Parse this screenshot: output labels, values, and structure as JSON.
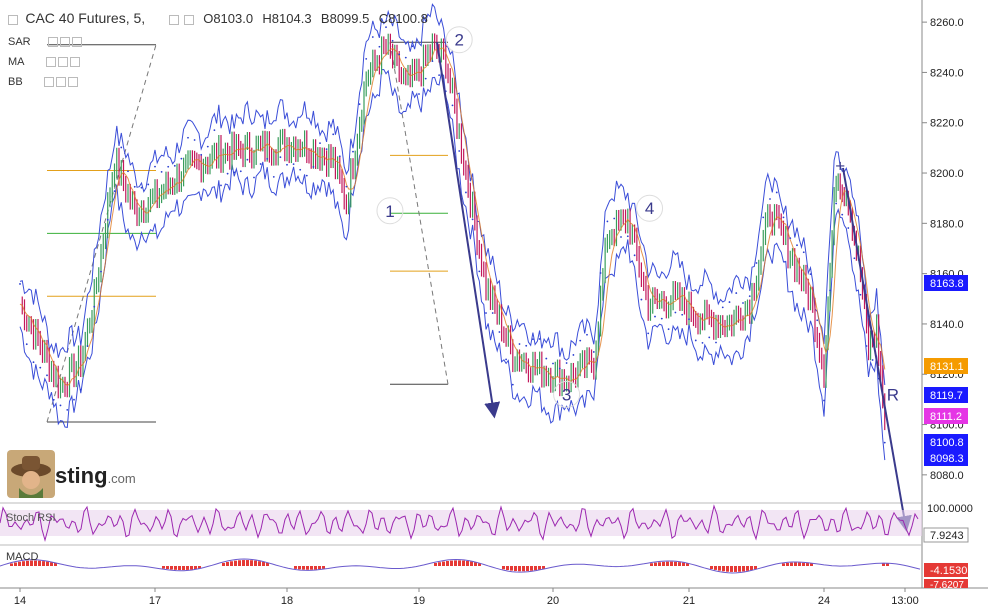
{
  "header": {
    "title": "CAC 40 Futures, 5,",
    "open": "O8103.0",
    "high": "H8104.3",
    "low": "B8099.5",
    "close": "C8100.8"
  },
  "indicators": [
    {
      "label": "SAR"
    },
    {
      "label": "MA"
    },
    {
      "label": "BB"
    }
  ],
  "sub_panels": {
    "stoch": {
      "label": "Stoch RSI",
      "top_value": "100.0000",
      "current_value": "7.9243"
    },
    "macd": {
      "label": "MACD",
      "value_1": "-4.1530",
      "value_2": "-7.6207"
    }
  },
  "logo": {
    "text": "sting",
    "suffix": ".com"
  },
  "colors": {
    "bollinger": "#3b4ed8",
    "sar": "#2b3fd0",
    "candle_up": "#3a9d5c",
    "candle_down": "#c2185b",
    "ma": "#e07b22",
    "arrow": "#3a3a8c",
    "stoch": "#9c27b0",
    "stoch_band": "#e9d3ec",
    "macd_hist": "#e53935"
  },
  "chart_data": {
    "type": "line",
    "title": "CAC 40 Futures, 5,",
    "xlabel": "",
    "ylabel": "",
    "x_ticks": [
      "14",
      "17",
      "18",
      "19",
      "20",
      "21",
      "24",
      "13:00"
    ],
    "y_ticks": [
      8080,
      8100,
      8120,
      8140,
      8160,
      8180,
      8200,
      8220,
      8240,
      8260
    ],
    "ylim": [
      8070,
      8268
    ],
    "grid": false,
    "price_path": [
      [
        0,
        8148
      ],
      [
        0.3,
        8115
      ],
      [
        0.45,
        8125
      ],
      [
        0.55,
        8150
      ],
      [
        0.7,
        8205
      ],
      [
        0.85,
        8185
      ],
      [
        1.0,
        8190
      ],
      [
        1.2,
        8200
      ],
      [
        1.5,
        8208
      ],
      [
        1.8,
        8210
      ],
      [
        2.1,
        8212
      ],
      [
        2.35,
        8205
      ],
      [
        2.45,
        8188
      ],
      [
        2.6,
        8238
      ],
      [
        2.75,
        8250
      ],
      [
        2.9,
        8235
      ],
      [
        3.0,
        8240
      ],
      [
        3.1,
        8250
      ],
      [
        3.2,
        8245
      ],
      [
        3.35,
        8200
      ],
      [
        3.5,
        8155
      ],
      [
        3.7,
        8128
      ],
      [
        3.9,
        8122
      ],
      [
        4.1,
        8118
      ],
      [
        4.3,
        8125
      ],
      [
        4.4,
        8175
      ],
      [
        4.55,
        8182
      ],
      [
        4.7,
        8148
      ],
      [
        4.9,
        8150
      ],
      [
        5.1,
        8142
      ],
      [
        5.3,
        8140
      ],
      [
        5.45,
        8148
      ],
      [
        5.6,
        8185
      ],
      [
        5.75,
        8168
      ],
      [
        5.9,
        8150
      ],
      [
        6.0,
        8122
      ],
      [
        6.15,
        8200
      ],
      [
        6.3,
        8190
      ],
      [
        6.45,
        8160
      ],
      [
        6.55,
        8130
      ],
      [
        6.65,
        8138
      ],
      [
        6.75,
        8100.8
      ]
    ],
    "price_labels": [
      {
        "value": 8163.8,
        "text": "8163.8",
        "color": "#1a1aff"
      },
      {
        "value": 8131.1,
        "text": "8131.1",
        "color": "#f59b00"
      },
      {
        "value": 8119.7,
        "text": "8119.7",
        "color": "#1a1aff"
      },
      {
        "value": 8111.2,
        "text": "8111.2",
        "color": "#e535e5"
      },
      {
        "value": 8100.8,
        "text": "8100.8",
        "color": "#1a1aff"
      },
      {
        "value": 8098.3,
        "text": "8098.3",
        "color": "#1a1aff"
      }
    ],
    "wave_labels": [
      {
        "text": "1",
        "x": 2.78,
        "y": 8185
      },
      {
        "text": "2",
        "x": 3.3,
        "y": 8253
      },
      {
        "text": "3",
        "x": 4.1,
        "y": 8112
      },
      {
        "text": "4",
        "x": 4.71,
        "y": 8186
      },
      {
        "text": "R",
        "x": 6.85,
        "y": 8112
      },
      {
        "text": "+",
        "x": 6.2,
        "y": 8203
      }
    ],
    "fib_levels_left": [
      8101,
      8151,
      8176,
      8201,
      8251
    ],
    "fib_levels_mid": [
      8116,
      8161,
      8184,
      8207,
      8252
    ]
  }
}
